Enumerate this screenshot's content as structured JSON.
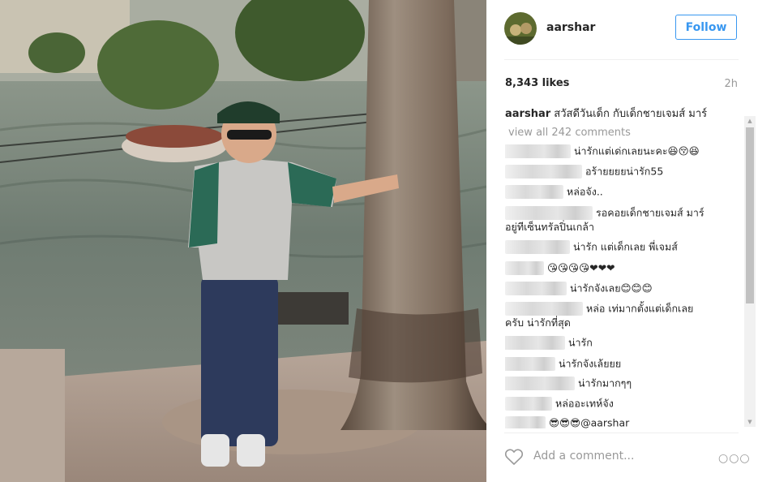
{
  "post": {
    "username": "aarshar",
    "follow_label": "Follow",
    "likes": "8,343 likes",
    "time_ago": "2h",
    "caption_user": "aarshar",
    "caption_text": " สวัสดีวันเด็ก กับเด็กชายเจมส์ มาร์",
    "view_all": "view all 242 comments",
    "comments": [
      {
        "text": "น่ารักแต่เด่กเลยนะคะ😆😚😆"
      },
      {
        "text": "อร้ายยยยน่ารัก55"
      },
      {
        "text": "หล่อจัง.."
      },
      {
        "text": "รอคอยเด็กชายเจมส์ มาร์",
        "text2": "อยู่ทีเซ็นทรัลปิ่นเกล้า"
      },
      {
        "text": "น่ารัก แต่เด็กเลย พี่เจมส์"
      },
      {
        "text": "😘😘😘😘❤❤❤"
      },
      {
        "text": "น่ารักจังเลย😊😊😊"
      },
      {
        "text": "หล่อ เท่มากตั้งแต่เด็กเลย",
        "text2": "ครับ น่ารักที่สุด"
      },
      {
        "text": "น่ารัก"
      },
      {
        "text": "น่ารักจังเล้ยยย"
      },
      {
        "text": "น่ารักมากๆๆ"
      },
      {
        "text": "หล่ออะเทห์จัง"
      },
      {
        "text": "😎😎😎@aarshar"
      }
    ],
    "add_comment_placeholder": "Add a comment...",
    "more_label": "○○○"
  },
  "icons": {
    "avatar": "avatar",
    "heart": "heart-icon",
    "more": "more-options-icon"
  },
  "colors": {
    "accent": "#3897f0",
    "muted": "#999999",
    "divider": "#efefef"
  }
}
